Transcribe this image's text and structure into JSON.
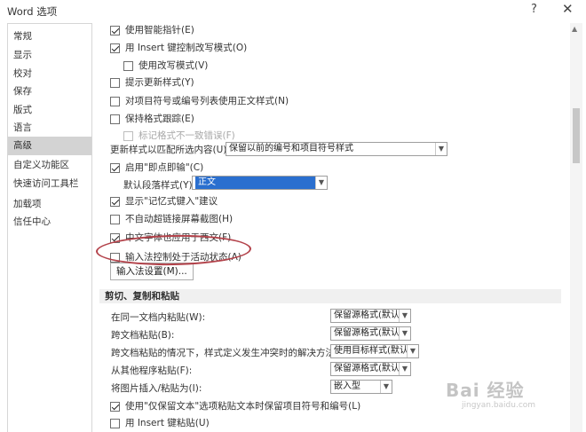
{
  "window": {
    "title": "Word 选项",
    "help": "?",
    "close": "✕"
  },
  "sidebar": {
    "items": [
      {
        "label": "常规"
      },
      {
        "label": "显示"
      },
      {
        "label": "校对"
      },
      {
        "label": "保存"
      },
      {
        "label": "版式"
      },
      {
        "label": "语言"
      },
      {
        "label": "高级",
        "active": true
      },
      {
        "label": "自定义功能区"
      },
      {
        "label": "快速访问工具栏"
      },
      {
        "label": "加载项"
      },
      {
        "label": "信任中心"
      }
    ]
  },
  "editing": {
    "smart_pointer": {
      "label": "使用智能指针(E)",
      "checked": true
    },
    "insert_overtype": {
      "label": "用 Insert 键控制改写模式(O)",
      "checked": true
    },
    "use_overtype": {
      "label": "使用改写模式(V)",
      "checked": false
    },
    "prompt_update_style": {
      "label": "提示更新样式(Y)",
      "checked": false
    },
    "normal_style_bullets": {
      "label": "对项目符号或编号列表使用正文样式(N)",
      "checked": false
    },
    "track_formatting": {
      "label": "保持格式跟踪(E)",
      "checked": false
    },
    "mark_inconsistencies": {
      "label": "标记格式不一致错误(F)",
      "checked": false,
      "disabled": true
    },
    "update_style_label": "更新样式以匹配所选内容(U):",
    "update_style_value": "保留以前的编号和项目符号样式",
    "click_and_type": {
      "label": "启用\"即点即输\"(C)",
      "checked": true
    },
    "default_para_label": "默认段落样式(Y):",
    "default_para_value": "正文",
    "autocomplete": {
      "label": "显示\"记忆式键入\"建议",
      "checked": true
    },
    "no_auto_hyperlink": {
      "label": "不自动超链接屏幕截图(H)",
      "checked": false
    },
    "chinese_font_west": {
      "label": "中文字体也应用于西文(F)",
      "checked": true
    },
    "ime_active": {
      "label": "输入法控制处于活动状态(A)",
      "checked": false
    },
    "ime_settings_button": "输入法设置(M)..."
  },
  "cut_copy_paste": {
    "section_title": "剪切、复制和粘贴",
    "rows": [
      {
        "label": "在同一文档内粘贴(W):",
        "value": "保留源格式(默认)"
      },
      {
        "label": "跨文档粘贴(B):",
        "value": "保留源格式(默认)"
      },
      {
        "label": "跨文档粘贴的情况下，样式定义发生冲突时的解决方法(E):",
        "value": "使用目标样式(默认)"
      },
      {
        "label": "从其他程序粘贴(F):",
        "value": "保留源格式(默认)"
      },
      {
        "label": "将图片插入/粘贴为(I):",
        "value": "嵌入型"
      }
    ],
    "keep_bullets": {
      "label": "使用\"仅保留文本\"选项粘贴文本时保留项目符号和编号(L)",
      "checked": true
    },
    "insert_key_paste": {
      "label": "用 Insert 键粘贴(U)",
      "checked": false
    }
  },
  "watermark": {
    "text": "Bai 经验",
    "sub": "jingyan.baidu.com"
  }
}
